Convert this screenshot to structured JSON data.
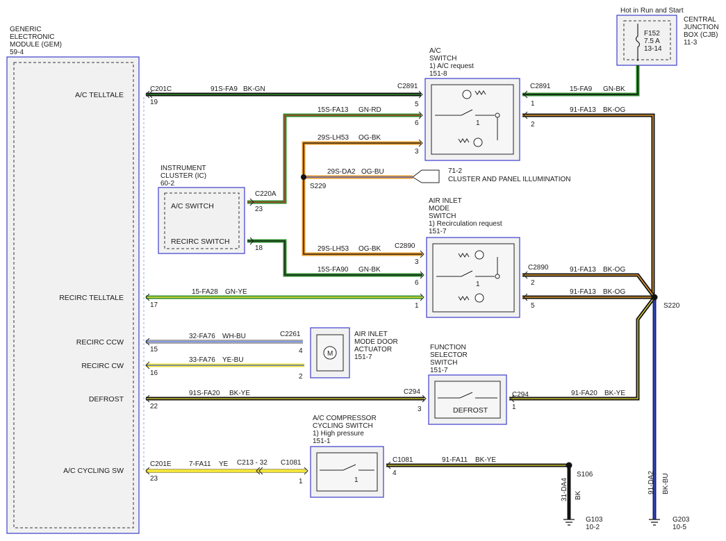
{
  "gem": {
    "lines": [
      "GENERIC",
      "ELECTRONIC",
      "MODULE (GEM)",
      "59-4"
    ]
  },
  "gem_labels": {
    "ac_telltale": "A/C TELLTALE",
    "recirc_telltale": "RECIRC TELLTALE",
    "recirc_ccw": "RECIRC CCW",
    "recirc_cw": "RECIRC CW",
    "defrost": "DEFROST",
    "ac_cycling_sw": "A/C CYCLING SW"
  },
  "cjb": {
    "header": "Hot in Run and Start",
    "lines": [
      "CENTRAL",
      "JUNCTION",
      "BOX (CJB)",
      "11-3"
    ],
    "fuse": [
      "F152",
      "7.5 A",
      "13-14"
    ]
  },
  "ac_switch": {
    "lines": [
      "A/C",
      "SWITCH",
      "1) A/C request",
      "151-8"
    ]
  },
  "ic": {
    "lines": [
      "INSTRUMENT",
      "CLUSTER (IC)",
      "60-2"
    ],
    "ac_switch": "A/C SWITCH",
    "recirc_switch": "RECIRC SWITCH"
  },
  "air_inlet": {
    "lines": [
      "AIR INLET",
      "MODE",
      "SWITCH",
      "1) Recirculation request",
      "151-7"
    ]
  },
  "actuator": {
    "lines": [
      "AIR INLET",
      "MODE DOOR",
      "ACTUATOR",
      "151-7"
    ],
    "motor": "M"
  },
  "function_selector": {
    "lines": [
      "FUNCTION",
      "SELECTOR",
      "SWITCH",
      "151-7"
    ],
    "defrost": "DEFROST"
  },
  "compressor": {
    "lines": [
      "A/C COMPRESSOR",
      "CYCLING SWITCH",
      "1) High pressure",
      "151-1"
    ]
  },
  "illumination": {
    "lines": [
      "71-2",
      "CLUSTER AND PANEL ILLUMINATION"
    ]
  },
  "connectors": {
    "c201c": "C201C",
    "c2891_l": "C2891",
    "c2891_r": "C2891",
    "c220a": "C220A",
    "c2890_l": "C2890",
    "c2890_r": "C2890",
    "c2261": "C2261",
    "c294_l": "C294",
    "c294_r": "C294",
    "c201e": "C201E",
    "c213": "C213 - 32",
    "c1081_l": "C1081",
    "c1081_r": "C1081"
  },
  "splices": {
    "s229": "S229",
    "s220": "S220",
    "s106": "S106"
  },
  "pins": {
    "p19": "19",
    "p5a": "5",
    "p1a": "1",
    "p6a": "6",
    "p2a": "2",
    "p3a": "3",
    "p23a": "23",
    "p18": "18",
    "p3b": "3",
    "p6b": "6",
    "p2b": "2",
    "p1b": "1",
    "p5b": "5",
    "p17": "17",
    "p15": "15",
    "p4": "4",
    "p16": "16",
    "p2c": "2",
    "p22": "22",
    "p3c": "3",
    "p1c": "1",
    "p23b": "23",
    "p1d": "1",
    "p4b": "4",
    "sw1a": "1",
    "sw1b": "1",
    "sw1c": "1"
  },
  "wires": [
    {
      "id": "91S-FA9",
      "color": "BK-GN"
    },
    {
      "id": "15-FA9",
      "color": "GN-BK"
    },
    {
      "id": "15S-FA13",
      "color": "GN-RD"
    },
    {
      "id": "91-FA13",
      "color": "BK-OG"
    },
    {
      "id": "29S-LH53",
      "color": "OG-BK"
    },
    {
      "id": "29S-DA2",
      "color": "OG-BU"
    },
    {
      "id": "29S-LH53",
      "color": "OG-BK"
    },
    {
      "id": "15S-FA90",
      "color": "GN-BK"
    },
    {
      "id": "91-FA13",
      "color": "BK-OG"
    },
    {
      "id": "91-FA13",
      "color": "BK-OG"
    },
    {
      "id": "15-FA28",
      "color": "GN-YE"
    },
    {
      "id": "32-FA76",
      "color": "WH-BU"
    },
    {
      "id": "33-FA76",
      "color": "YE-BU"
    },
    {
      "id": "91S-FA20",
      "color": "BK-YE"
    },
    {
      "id": "91-FA20",
      "color": "BK-YE"
    },
    {
      "id": "7-FA11",
      "color": "YE"
    },
    {
      "id": "91-FA11",
      "color": "BK-YE"
    }
  ],
  "grounds": {
    "g103_wire": "31-DA4",
    "g103_color": "BK",
    "g103": [
      "G103",
      "10-2"
    ],
    "g203_wire": "91-DA2",
    "g203_color": "BK-BU",
    "g203": [
      "G203",
      "10-5"
    ]
  },
  "colors": {
    "module_border": "#3c3ccd",
    "black": "#111111",
    "green": "#2e8b2e",
    "orange": "#e69a2e",
    "yellow": "#f2e43a",
    "navy": "#1a1f6b",
    "light_blue": "#8aa8e0"
  }
}
